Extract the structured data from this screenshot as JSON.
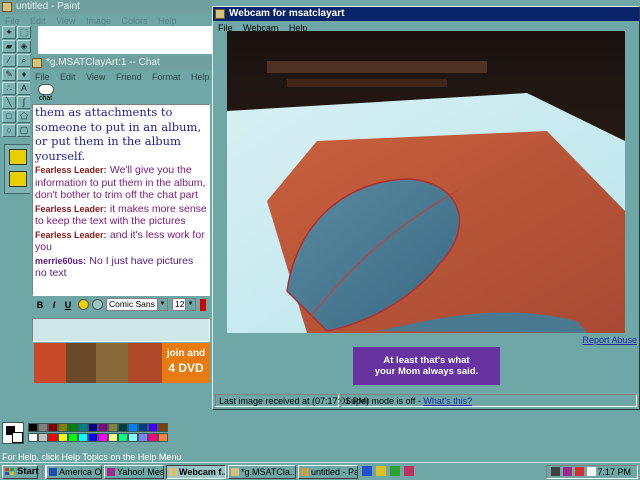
{
  "paint": {
    "title": "untitled - Paint",
    "menu": [
      "File",
      "Edit",
      "View",
      "Image",
      "Colors",
      "Help"
    ],
    "status": "For Help, click Help Topics on the Help Menu."
  },
  "chat": {
    "title": "*g.MSATClayArt:1 -- Chat",
    "menu": [
      "File",
      "Edit",
      "View",
      "Friend",
      "Format",
      "Help"
    ],
    "toolbar_label": "chat",
    "messages": [
      {
        "sender": "",
        "text": "them as attachments to someone to put in an album, or put them in the album yourself.",
        "style": "big"
      },
      {
        "sender": "Fearless Leader:",
        "text": "We'll give you the information to put them in the album, don't bother to trim off the chat part",
        "style": "normal"
      },
      {
        "sender": "Fearless Leader:",
        "text": "it makes more sense to keep the text with the pictures",
        "style": "normal"
      },
      {
        "sender": "Fearless Leader:",
        "text": "and it's less work for you",
        "style": "normal"
      },
      {
        "sender": "merrie60us:",
        "text": "No I just have pictures no text",
        "style": "other"
      }
    ],
    "format": {
      "bold": "B",
      "italic": "I",
      "underline": "U",
      "font": "Comic Sans MS",
      "size": "12"
    },
    "ad": {
      "line1": "join and",
      "line2": "4 DVD"
    }
  },
  "webcam": {
    "title": "Webcam for msatclayart",
    "menu": [
      "File",
      "Webcam",
      "Help"
    ],
    "report_abuse": "Report Abuse",
    "ad": {
      "line1": "At least that's what",
      "line2": "your Mom always said."
    },
    "status_received": "Last image received at (07:17:01 PM)",
    "status_super": "Super mode is off - ",
    "status_link": "What's this?"
  },
  "taskbar": {
    "start": "Start",
    "tasks": [
      {
        "label": "America Onli...",
        "color": "#1f4fa8"
      },
      {
        "label": "Yahoo! Mess...",
        "color": "#a02a8a"
      },
      {
        "label": "Webcam f...",
        "color": "#d8c078"
      },
      {
        "label": "*g.MSATCla...",
        "color": "#d8c078"
      },
      {
        "label": "untitled - Paint",
        "color": "#c8a040"
      }
    ],
    "clock": "7:17 PM"
  },
  "colors": {
    "title_active": "#0a246a",
    "desktop": "#6fa7a7",
    "sender": "#8b1a1a",
    "message": "#7b1a7b",
    "ad_purple": "#6633a0"
  }
}
